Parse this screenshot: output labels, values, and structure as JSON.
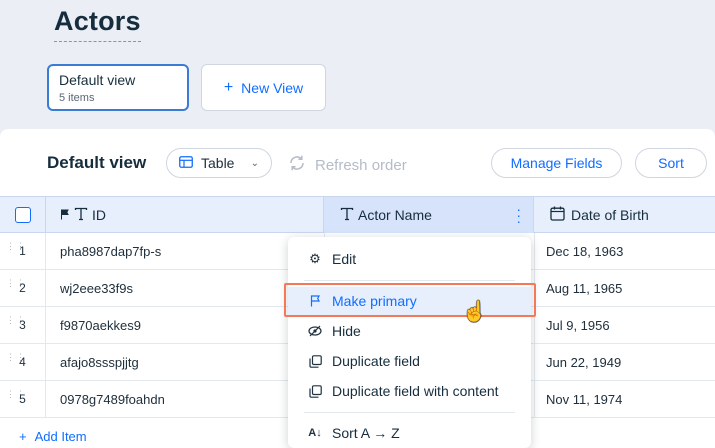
{
  "page": {
    "title": "Actors"
  },
  "views": {
    "default": {
      "name": "Default view",
      "count": "5 items"
    },
    "new_view_label": "New View"
  },
  "toolbar": {
    "title": "Default view",
    "layout_select": "Table",
    "refresh_label": "Refresh order",
    "manage_fields_label": "Manage Fields",
    "sort_label": "Sort"
  },
  "table": {
    "columns": [
      "ID",
      "Actor Name",
      "Date of Birth"
    ],
    "rows": [
      {
        "num": "1",
        "id": "pha8987dap7fp-s",
        "dob": "Dec 18, 1963"
      },
      {
        "num": "2",
        "id": "wj2eee33f9s",
        "dob": "Aug 11, 1965"
      },
      {
        "num": "3",
        "id": "f9870aekkes9",
        "dob": "Jul 9, 1956"
      },
      {
        "num": "4",
        "id": "afajo8ssspjjtg",
        "dob": "Jun 22, 1949"
      },
      {
        "num": "5",
        "id": "0978g7489foahdn",
        "dob": "Nov 11, 1974"
      }
    ],
    "add_item_label": "Add Item"
  },
  "context_menu": {
    "items": [
      {
        "label": "Edit",
        "icon": "gear-icon"
      },
      {
        "label": "Make primary",
        "icon": "flag-icon"
      },
      {
        "label": "Hide",
        "icon": "eye-off-icon"
      },
      {
        "label": "Duplicate field",
        "icon": "duplicate-icon"
      },
      {
        "label": "Duplicate field with content",
        "icon": "duplicate-icon"
      },
      {
        "label": "Sort A → Z",
        "icon": "sort-az-icon"
      }
    ]
  },
  "colors": {
    "accent": "#116dff",
    "highlight": "#f4795a",
    "header_bg": "#e7effd"
  }
}
